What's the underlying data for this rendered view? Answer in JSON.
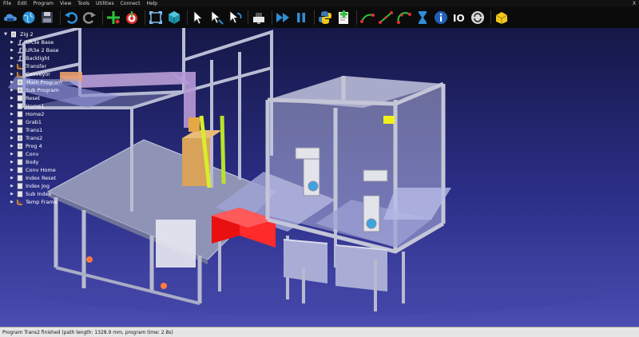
{
  "menu": {
    "items": [
      "File",
      "Edit",
      "Program",
      "View",
      "Tools",
      "Utilities",
      "Connect",
      "Help"
    ],
    "close": "X"
  },
  "toolbar": {
    "icons": [
      "cloud-open-icon",
      "globe-icon",
      "save-icon",
      "undo-icon",
      "redo-icon",
      "add-target-icon",
      "target-icon",
      "fit-view-icon",
      "view-cube-icon",
      "select-pointer-icon",
      "select-move-icon",
      "select-rotate-icon",
      "station-icon",
      "run-program-icon",
      "pause-icon",
      "python-icon",
      "new-program-icon",
      "move-joint-icon",
      "move-linear-icon",
      "move-circular-icon",
      "pause-instruction-icon",
      "info-icon",
      "io-icon",
      "sync-icon",
      "package-icon"
    ],
    "io_label": "IO",
    "colors": {
      "blue": "#2f8fd6",
      "green": "#2cc43c",
      "yellow": "#f2c81e",
      "red": "#e03030"
    }
  },
  "tree": {
    "root": "Zig 2",
    "items": [
      {
        "label": "UR3e Base",
        "icon": "robot-base-icon",
        "selected": false
      },
      {
        "label": "UR3e 2 Base",
        "icon": "robot-base-icon",
        "selected": false
      },
      {
        "label": "Backlight",
        "icon": "robot-base-icon",
        "selected": false
      },
      {
        "label": "Transfer",
        "icon": "frame-icon",
        "selected": false
      },
      {
        "label": "Conveyor",
        "icon": "frame-icon",
        "selected": false
      },
      {
        "label": "Main Program",
        "icon": "program-icon",
        "selected": true
      },
      {
        "label": "Sub Program",
        "icon": "program-icon",
        "selected": false
      },
      {
        "label": "Reset",
        "icon": "target-icon",
        "selected": false
      },
      {
        "label": "Home1",
        "icon": "target-icon",
        "selected": false
      },
      {
        "label": "Home2",
        "icon": "target-icon",
        "selected": false
      },
      {
        "label": "Grab1",
        "icon": "target-icon",
        "selected": false
      },
      {
        "label": "Trans1",
        "icon": "target-icon",
        "selected": false
      },
      {
        "label": "Trans2",
        "icon": "program-icon",
        "selected": false
      },
      {
        "label": "Prog 4",
        "icon": "program-icon",
        "selected": false
      },
      {
        "label": "Conv",
        "icon": "target-icon",
        "selected": false
      },
      {
        "label": "Body",
        "icon": "target-icon",
        "selected": false
      },
      {
        "label": "Conv Home",
        "icon": "target-icon",
        "selected": false
      },
      {
        "label": "Index Reset",
        "icon": "target-icon",
        "selected": false
      },
      {
        "label": "Index Jog",
        "icon": "target-icon",
        "selected": false
      },
      {
        "label": "Sub Index",
        "icon": "target-icon",
        "selected": false
      },
      {
        "label": "Temp Frame",
        "icon": "frame-icon",
        "selected": false
      }
    ]
  },
  "status": {
    "text": "Program Trans2 finished (path length: 1328.9 mm, program time: 2.8s)"
  }
}
